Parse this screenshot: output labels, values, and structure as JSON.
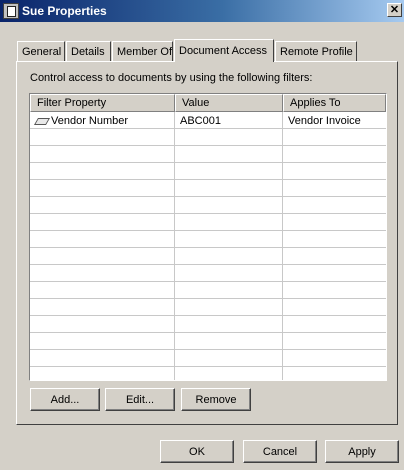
{
  "window": {
    "title": "Sue Properties",
    "close_glyph": "✕"
  },
  "tabs": [
    {
      "label": "General"
    },
    {
      "label": "Details"
    },
    {
      "label": "Member Of"
    },
    {
      "label": "Document Access",
      "active": true
    },
    {
      "label": "Remote Profile"
    }
  ],
  "panel": {
    "description": "Control access to documents by using the following filters:"
  },
  "table": {
    "columns": [
      "Filter Property",
      "Value",
      "Applies To"
    ],
    "rows": [
      {
        "icon": "filter-property-icon",
        "property": "Vendor Number",
        "value": "ABC001",
        "applies_to": "Vendor Invoice"
      }
    ]
  },
  "panel_buttons": {
    "add": "Add...",
    "edit": "Edit...",
    "remove": "Remove"
  },
  "dialog_buttons": {
    "ok": "OK",
    "cancel": "Cancel",
    "apply": "Apply"
  }
}
